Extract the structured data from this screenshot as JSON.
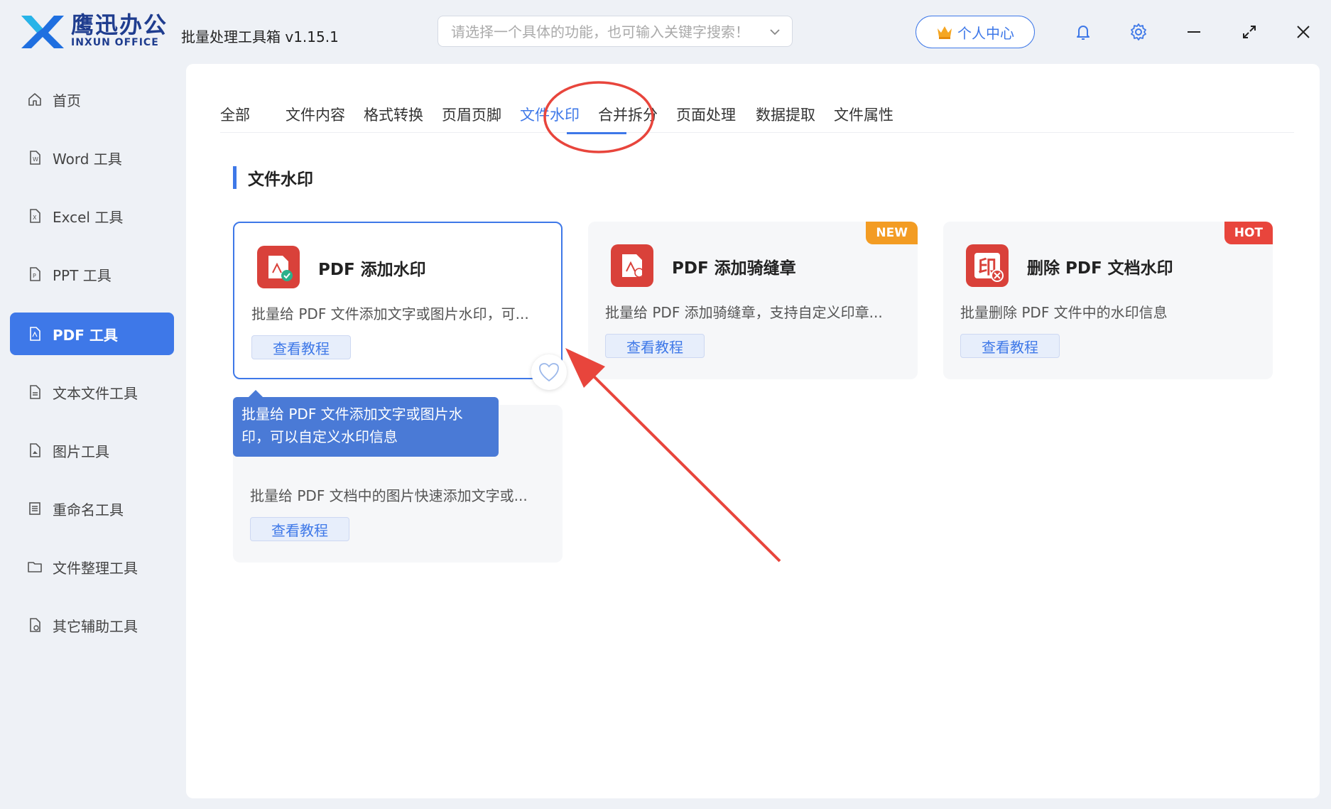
{
  "app": {
    "brand_cn": "鹰迅办公",
    "brand_en": "INXUN OFFICE",
    "title": "批量处理工具箱 v1.15.1"
  },
  "search": {
    "placeholder": "请选择一个具体的功能，也可输入关键字搜索！"
  },
  "header": {
    "user_center": "个人中心",
    "icons": [
      "bell-icon",
      "gear-icon",
      "minimize-icon",
      "maximize-icon",
      "close-icon"
    ]
  },
  "sidebar": {
    "items": [
      {
        "label": "首页",
        "icon": "home-icon"
      },
      {
        "label": "Word 工具",
        "icon": "word-doc-icon"
      },
      {
        "label": "Excel 工具",
        "icon": "excel-doc-icon"
      },
      {
        "label": "PPT 工具",
        "icon": "ppt-doc-icon"
      },
      {
        "label": "PDF 工具",
        "icon": "pdf-doc-icon",
        "active": true
      },
      {
        "label": "文本文件工具",
        "icon": "text-doc-icon"
      },
      {
        "label": "图片工具",
        "icon": "image-doc-icon"
      },
      {
        "label": "重命名工具",
        "icon": "list-icon"
      },
      {
        "label": "文件整理工具",
        "icon": "folder-icon"
      },
      {
        "label": "其它辅助工具",
        "icon": "misc-doc-icon"
      }
    ]
  },
  "tabs": [
    {
      "label": "全部"
    },
    {
      "label": "文件内容"
    },
    {
      "label": "格式转换"
    },
    {
      "label": "页眉页脚"
    },
    {
      "label": "文件水印",
      "active": true
    },
    {
      "label": "合并拆分"
    },
    {
      "label": "页面处理"
    },
    {
      "label": "数据提取"
    },
    {
      "label": "文件属性"
    }
  ],
  "section": {
    "title": "文件水印"
  },
  "cards": [
    {
      "title": "PDF 添加水印",
      "desc": "批量给 PDF 文件添加文字或图片水印，可...",
      "button": "查看教程",
      "badge": "",
      "selected": true
    },
    {
      "title": "PDF 添加骑缝章",
      "desc": "批量给 PDF 添加骑缝章，支持自定义印章...",
      "button": "查看教程",
      "badge": "NEW"
    },
    {
      "title": "删除 PDF 文档水印",
      "desc": "批量删除 PDF 文件中的水印信息",
      "button": "查看教程",
      "badge": "HOT"
    },
    {
      "title": "",
      "desc": "批量给 PDF 文档中的图片快速添加文字或...",
      "button": "查看教程",
      "badge": ""
    }
  ],
  "tooltip": {
    "line1": "批量给 PDF 文件添加文字或图片水",
    "line2": "印，可以自定义水印信息"
  },
  "colors": {
    "accent": "#3e78e8",
    "brand": "#1f3d8f",
    "badge_new": "#f39c23",
    "badge_hot": "#e8453c",
    "annotation_red": "#e8453c",
    "card_icon_red": "#d9413a"
  }
}
